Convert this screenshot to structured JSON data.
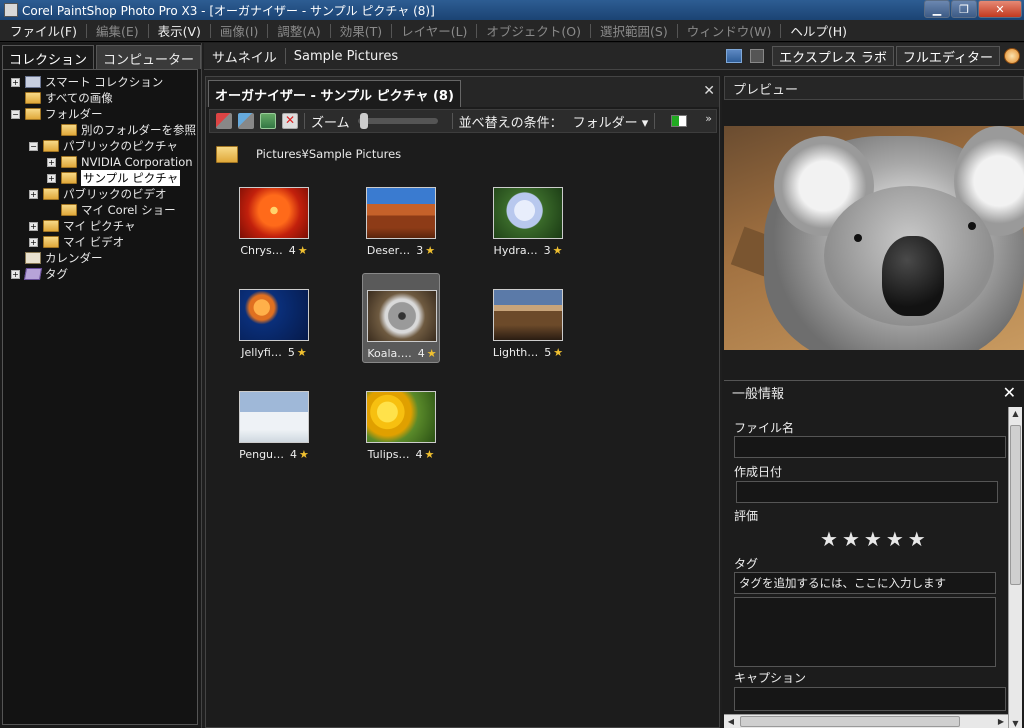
{
  "window": {
    "title": "Corel PaintShop Photo Pro X3 - [オーガナイザー - サンプル ピクチャ (8)]",
    "min_glyph": "▁",
    "max_glyph": "❐",
    "close_glyph": "✕"
  },
  "menu": [
    {
      "label": "ファイル(F)",
      "dim": false
    },
    {
      "label": "編集(E)",
      "dim": true
    },
    {
      "label": "表示(V)",
      "dim": false
    },
    {
      "label": "画像(I)",
      "dim": true
    },
    {
      "label": "調整(A)",
      "dim": true
    },
    {
      "label": "効果(T)",
      "dim": true
    },
    {
      "label": "レイヤー(L)",
      "dim": true
    },
    {
      "label": "オブジェクト(O)",
      "dim": true
    },
    {
      "label": "選択範囲(S)",
      "dim": true
    },
    {
      "label": "ウィンドウ(W)",
      "dim": true
    },
    {
      "label": "ヘルプ(H)",
      "dim": false
    }
  ],
  "left_tabs": {
    "collection": "コレクション",
    "computer": "コンピューター"
  },
  "tree": [
    {
      "label": "スマート コレクション",
      "icon": "smart-collection-icon",
      "expander": "+"
    },
    {
      "label": "すべての画像",
      "icon": "folder-icon",
      "expander": ""
    },
    {
      "label": "フォルダー",
      "icon": "folder-icon",
      "expander": "−"
    },
    {
      "label": "別のフォルダーを参照",
      "icon": "folder-search-icon",
      "expander": ""
    },
    {
      "label": "パブリックのピクチャ",
      "icon": "folder-icon",
      "expander": "−"
    },
    {
      "label": "NVIDIA Corporation",
      "icon": "folder-icon",
      "expander": "+"
    },
    {
      "label": "サンプル ピクチャ",
      "icon": "folder-icon",
      "expander": "+",
      "selected": true
    },
    {
      "label": "パブリックのビデオ",
      "icon": "folder-icon",
      "expander": "+"
    },
    {
      "label": "マイ Corel ショー",
      "icon": "folder-icon",
      "expander": ""
    },
    {
      "label": "マイ ピクチャ",
      "icon": "folder-icon",
      "expander": "+"
    },
    {
      "label": "マイ ビデオ",
      "icon": "folder-icon",
      "expander": "+"
    },
    {
      "label": "カレンダー",
      "icon": "calendar-icon",
      "expander": ""
    },
    {
      "label": "タグ",
      "icon": "tag-icon",
      "expander": "+"
    }
  ],
  "topstrip": {
    "thumbnail": "サムネイル",
    "folder": "Sample Pictures",
    "express_lab": "エクスプレス ラボ",
    "full_editor": "フルエディター"
  },
  "organizer": {
    "tab_label": "オーガナイザー - サンプル ピクチャ (8)",
    "close": "✕",
    "zoom_label": "ズーム",
    "sort_label": "並べ替えの条件：",
    "sort_value": "フォルダー ▾",
    "more": "»",
    "path": "Pictures¥Sample Pictures"
  },
  "thumbnails": [
    {
      "name": "Chrys…",
      "rating": "4",
      "img": "chrysanthemum-image",
      "selected": false
    },
    {
      "name": "Deser…",
      "rating": "3",
      "img": "desert-image",
      "selected": false
    },
    {
      "name": "Hydra…",
      "rating": "3",
      "img": "hydrangeas-image",
      "selected": false
    },
    {
      "name": "Jellyfi…",
      "rating": "5",
      "img": "jellyfish-image",
      "selected": false
    },
    {
      "name": "Koala.…",
      "rating": "4",
      "img": "koala-image",
      "selected": true
    },
    {
      "name": "Lighth…",
      "rating": "5",
      "img": "lighthouse-image",
      "selected": false
    },
    {
      "name": "Pengu…",
      "rating": "4",
      "img": "penguins-image",
      "selected": false
    },
    {
      "name": "Tulips…",
      "rating": "4",
      "img": "tulips-image",
      "selected": false
    }
  ],
  "right": {
    "preview_label": "プレビュー",
    "general_info_label": "一般情報",
    "close": "✕",
    "filename_label": "ファイル名",
    "filename_value": "",
    "date_label": "作成日付",
    "date_value": "",
    "rating_label": "評価",
    "stars": [
      "★",
      "★",
      "★",
      "★",
      "★"
    ],
    "tags_label": "タグ",
    "tags_placeholder": "タグを追加するには、ここに入力します",
    "caption_label": "キャプション",
    "caption_value": ""
  }
}
